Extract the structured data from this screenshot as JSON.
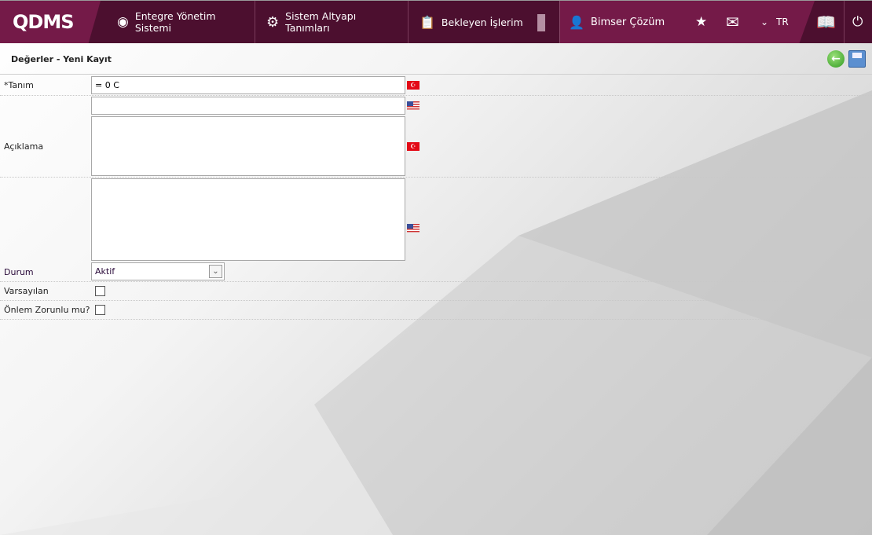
{
  "header": {
    "logo": "QDMS",
    "nav": [
      "Entegre Yönetim Sistemi",
      "Sistem Altyapı Tanımları",
      "Bekleyen İşlerim"
    ],
    "user": "Bimser Çözüm",
    "language": "TR"
  },
  "page": {
    "title": "Değerler - Yeni Kayıt"
  },
  "form": {
    "tanim_label": "*Tanım",
    "tanim_tr": "= 0 C",
    "tanim_en": "",
    "aciklama_label": "Açıklama",
    "aciklama_tr": "",
    "aciklama_en": "",
    "durum_label": "Durum",
    "durum_value": "Aktif",
    "varsayilan_label": "Varsayılan",
    "varsayilan_checked": false,
    "onlem_label": "Önlem Zorunlu mu?",
    "onlem_checked": false
  },
  "colors": {
    "header": "#4c0f2f",
    "accent": "#741a48"
  }
}
